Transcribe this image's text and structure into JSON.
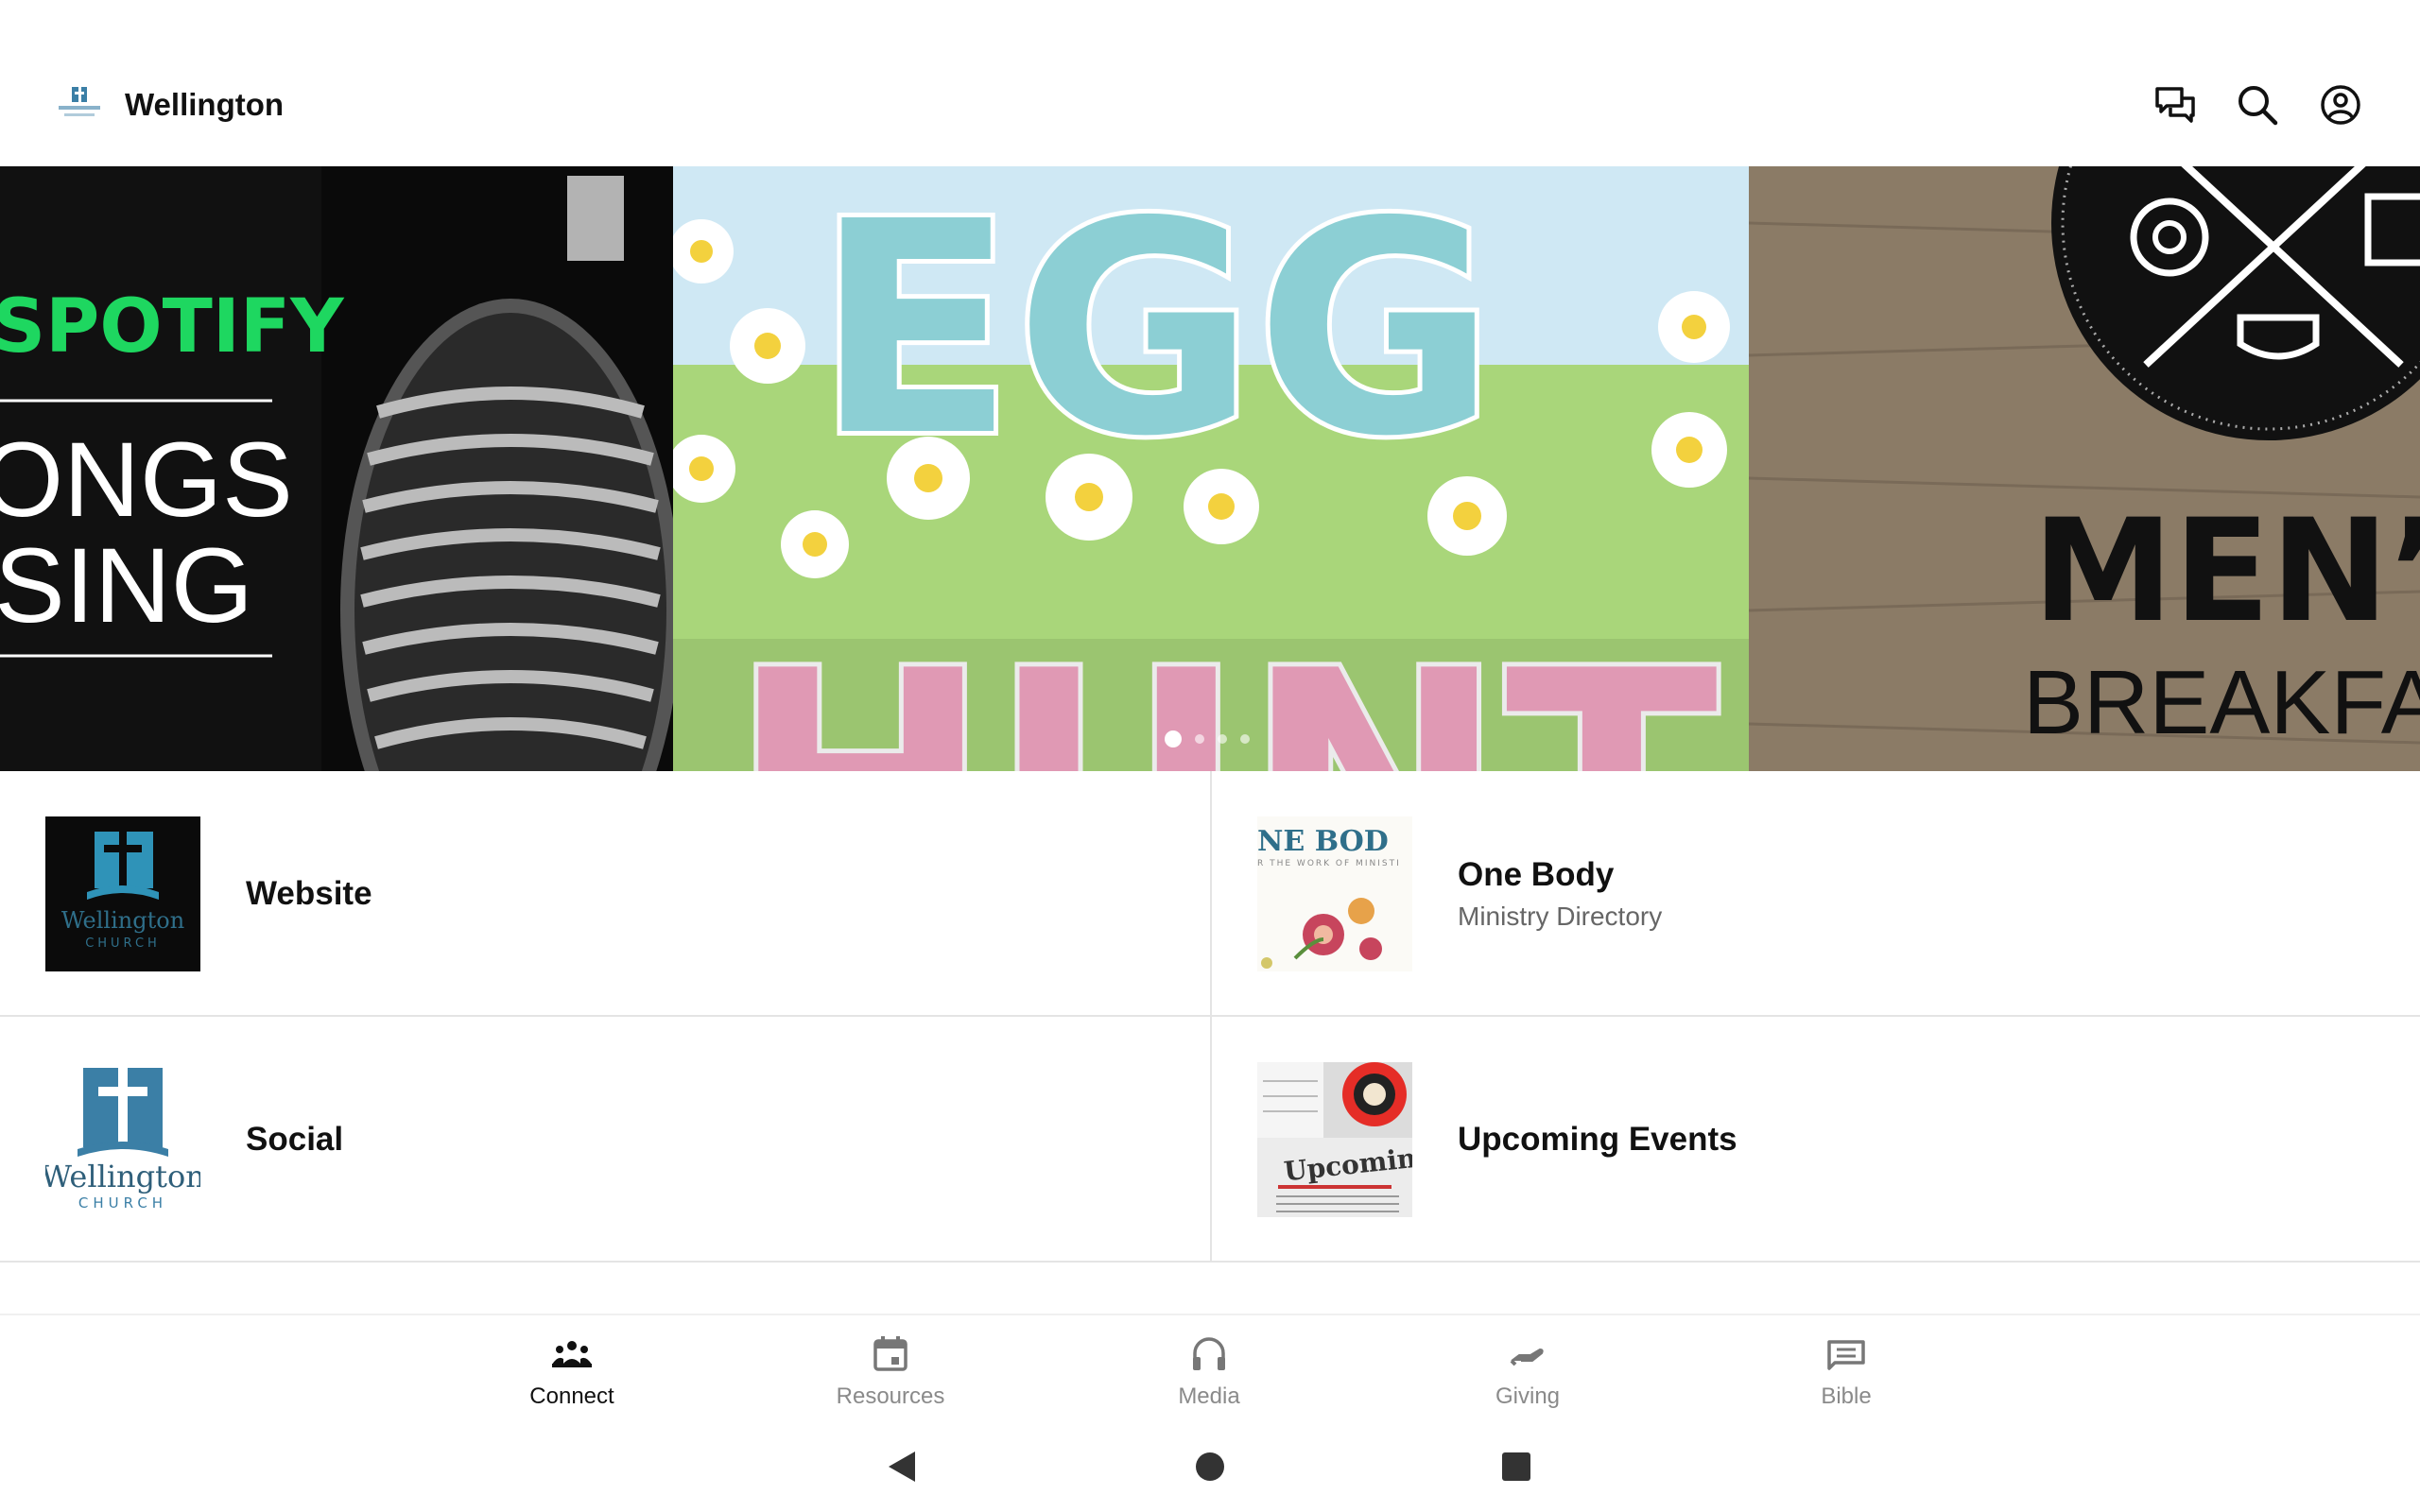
{
  "app": {
    "title": "Wellington"
  },
  "header_actions": [
    {
      "name": "chat-icon"
    },
    {
      "name": "search-icon"
    },
    {
      "name": "account-icon"
    }
  ],
  "carousel": {
    "slides": [
      {
        "id": "spotify-songs",
        "text_lines": [
          "SPOTIFY",
          "ONGS",
          "SING"
        ]
      },
      {
        "id": "egg-hunt",
        "text_lines": [
          "EGG",
          "HUNT"
        ]
      },
      {
        "id": "mens-breakfast",
        "text_lines": [
          "MEN’",
          "BREAKFA"
        ]
      }
    ],
    "page_count": 4,
    "active_index": 0
  },
  "tiles": [
    {
      "title": "Website",
      "subtitle": "",
      "thumb": "wellington-logo-dark"
    },
    {
      "title": "One Body",
      "subtitle": "Ministry Directory",
      "thumb": "one-body-flowers"
    },
    {
      "title": "Social",
      "subtitle": "",
      "thumb": "wellington-logo-light"
    },
    {
      "title": "Upcoming Events",
      "subtitle": "",
      "thumb": "upcoming-newspaper"
    }
  ],
  "thumb_text": {
    "wellington": "Wellington",
    "church": "CHURCH",
    "one_body": "NE BOD",
    "one_body_tag": "R THE WORK OF MINISTI",
    "upcoming": "Upcoming"
  },
  "bottom_nav": {
    "active": "connect",
    "items": [
      {
        "label": "Connect",
        "icon": "people-icon"
      },
      {
        "label": "Resources",
        "icon": "calendar-icon"
      },
      {
        "label": "Media",
        "icon": "headphones-icon"
      },
      {
        "label": "Giving",
        "icon": "giving-hand-icon"
      },
      {
        "label": "Bible",
        "icon": "bible-icon"
      }
    ]
  },
  "colors": {
    "brand_blue": "#3b7fa6",
    "active_text": "#111111",
    "inactive_text": "#8a8a8a",
    "divider": "#e4e4e4"
  }
}
